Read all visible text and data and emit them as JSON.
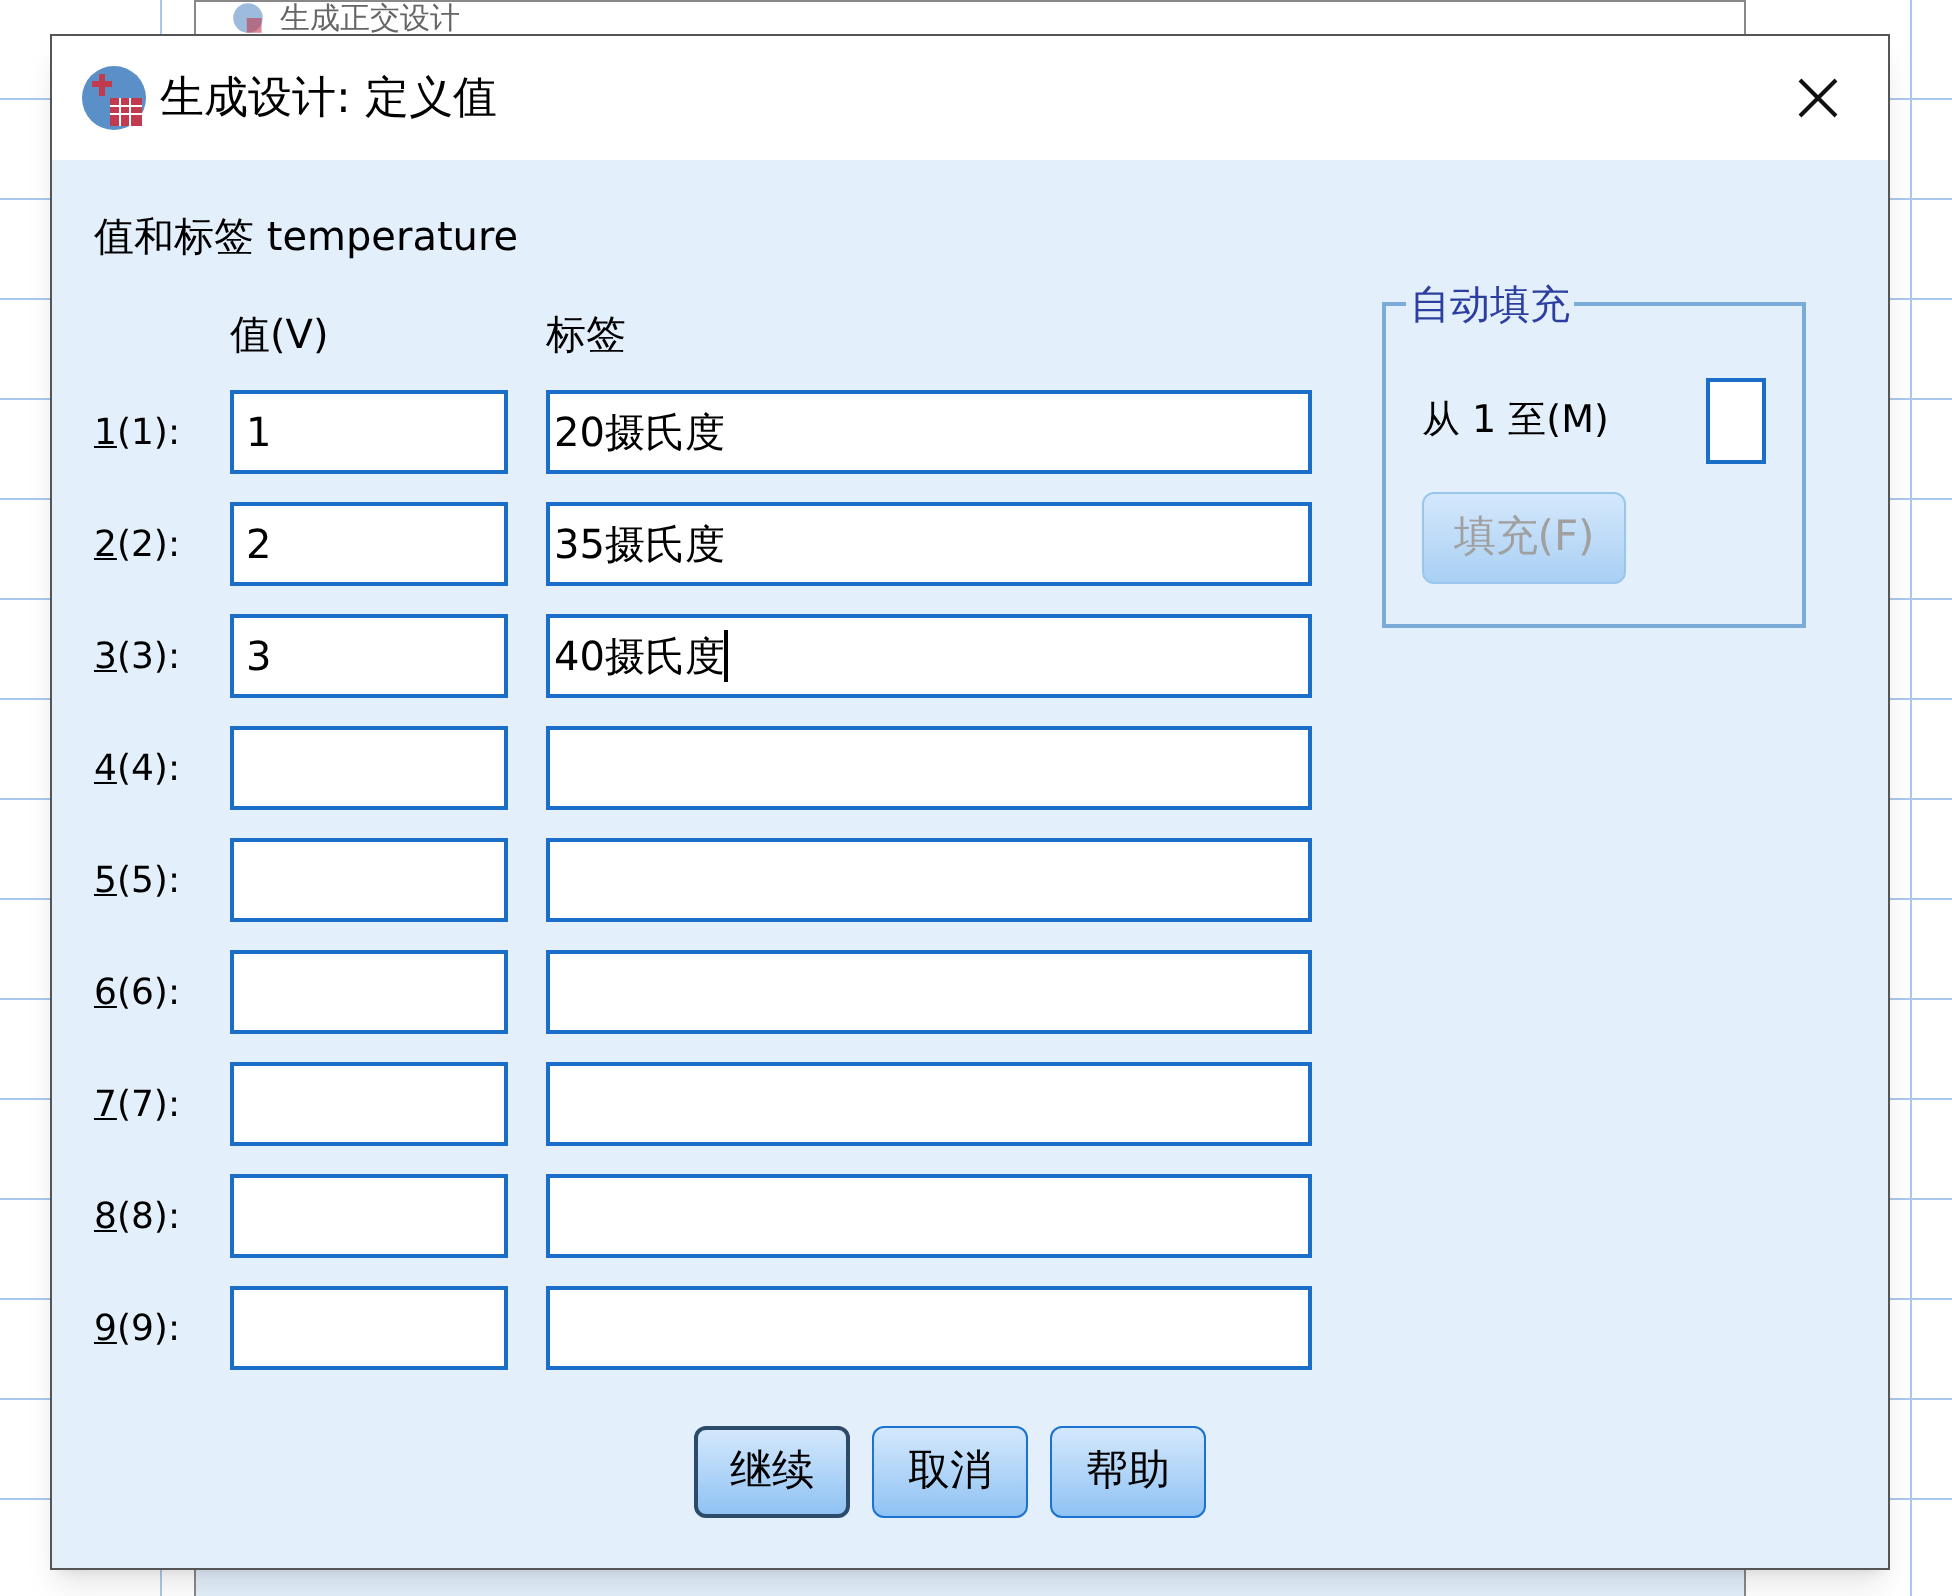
{
  "background_window": {
    "title": "生成正交设计"
  },
  "dialog": {
    "title": "生成设计: 定义值",
    "heading": "值和标签 temperature",
    "columns": [
      "值(V)",
      "标签"
    ],
    "rows": [
      {
        "label": "1(1):",
        "value": "1",
        "tag": "20摄氏度",
        "focused": false
      },
      {
        "label": "2(2):",
        "value": "2",
        "tag": "35摄氏度",
        "focused": false
      },
      {
        "label": "3(3):",
        "value": "3",
        "tag": "40摄氏度",
        "focused": true
      },
      {
        "label": "4(4):",
        "focused": false
      },
      {
        "label": "5(5):",
        "focused": false
      },
      {
        "label": "6(6):",
        "focused": false
      },
      {
        "label": "7(7):",
        "focused": false
      },
      {
        "label": "8(8):",
        "focused": false
      },
      {
        "label": "9(9):",
        "focused": false
      }
    ],
    "autofill": {
      "title": "自动填充",
      "range_label": "从 1 至(M)",
      "fill_button": {
        "label": "填充(F)",
        "disabled": true
      }
    },
    "buttons": [
      {
        "label": "继续",
        "default": true
      },
      {
        "label": "取消",
        "default": false
      },
      {
        "label": "帮助",
        "default": false
      }
    ]
  }
}
